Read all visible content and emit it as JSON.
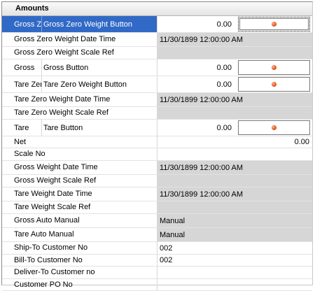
{
  "section": {
    "title": "Amounts"
  },
  "rows": {
    "gross_zero": {
      "label": "Gross Zero",
      "sub": "Gross Zero Weight Button",
      "value": "0.00",
      "button_icon": "orange-dot-icon"
    },
    "gross_zero_dt": {
      "label": "Gross Zero Weight Date Time",
      "value": "11/30/1899 12:00:00 AM"
    },
    "gross_zero_scale": {
      "label": "Gross Zero Weight Scale Ref",
      "value": ""
    },
    "gross": {
      "label": "Gross",
      "sub": "Gross Button",
      "value": "0.00"
    },
    "tare_zero": {
      "label": "Tare Zero \\",
      "sub": "Tare Zero Weight Button",
      "value": "0.00"
    },
    "tare_zero_dt": {
      "label": "Tare Zero Weight Date Time",
      "value": "11/30/1899 12:00:00 AM"
    },
    "tare_zero_scale": {
      "label": "Tare Zero Weight Scale Ref",
      "value": ""
    },
    "tare": {
      "label": "Tare",
      "sub": "Tare Button",
      "value": "0.00"
    },
    "net": {
      "label": "Net",
      "value": "0.00"
    },
    "scale_no": {
      "label": "Scale No",
      "value": ""
    },
    "gross_wt_dt": {
      "label": "Gross Weight Date Time",
      "value": "11/30/1899 12:00:00 AM"
    },
    "gross_wt_scale": {
      "label": "Gross Weight Scale Ref",
      "value": ""
    },
    "tare_wt_dt": {
      "label": "Tare Weight Date Time",
      "value": "11/30/1899 12:00:00 AM"
    },
    "tare_wt_scale": {
      "label": "Tare Weight Scale Ref",
      "value": ""
    },
    "gross_auto": {
      "label": "Gross Auto Manual",
      "value": "Manual"
    },
    "tare_auto": {
      "label": "Tare Auto Manual",
      "value": "Manual"
    },
    "ship_to": {
      "label": "Ship-To Customer No",
      "value": "002"
    },
    "bill_to": {
      "label": "Bill-To Customer No",
      "value": "002"
    },
    "deliver_to": {
      "label": "Deliver-To Customer no",
      "value": ""
    },
    "customer_po": {
      "label": "Customer PO No",
      "value": ""
    }
  },
  "colors": {
    "selection": "#3169c6",
    "readonly_bg": "#d6d6d6",
    "dot": "#e0561e"
  }
}
